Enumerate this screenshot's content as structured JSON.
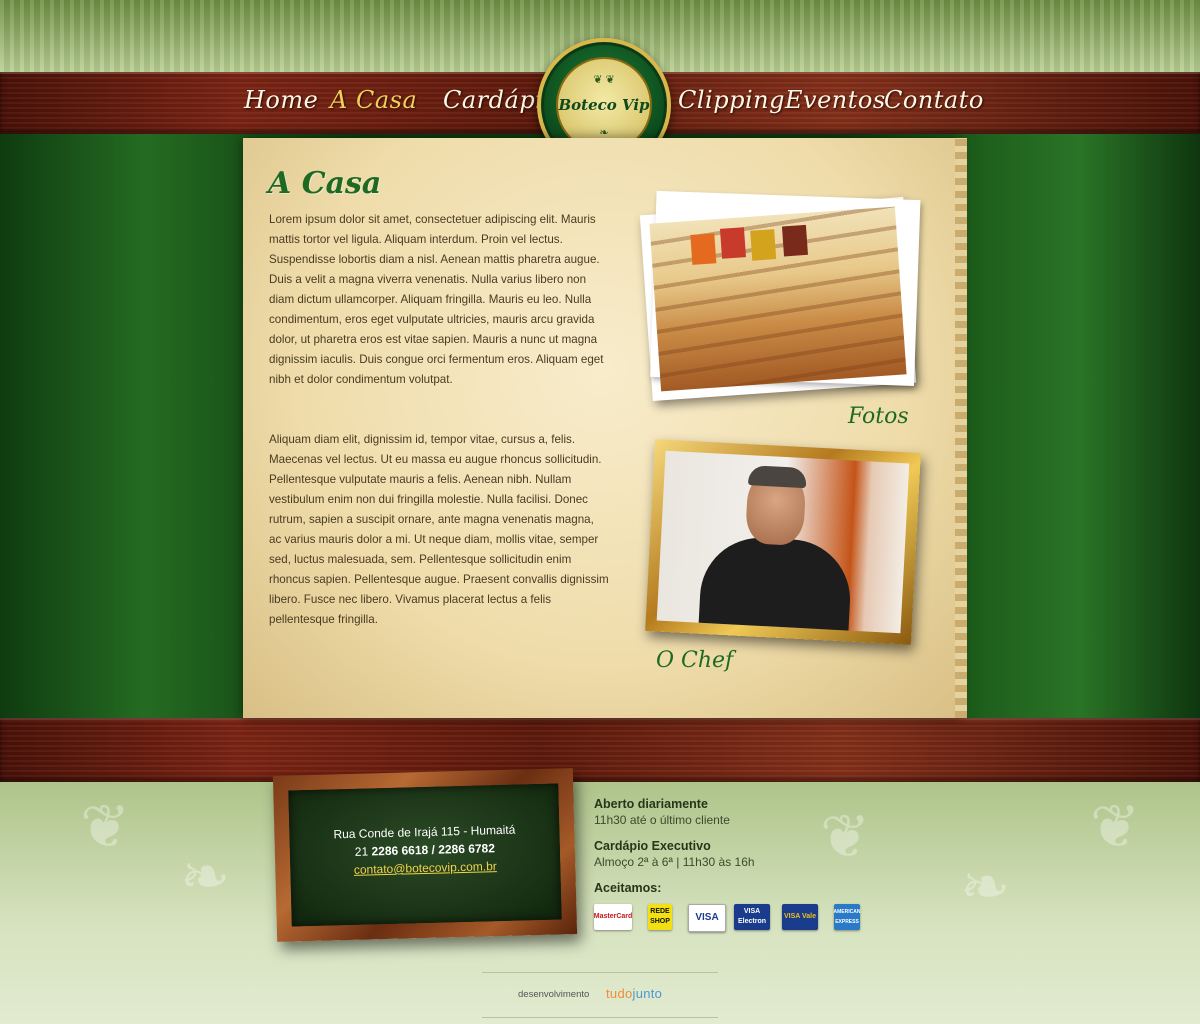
{
  "nav": {
    "items": [
      "Home",
      "A Casa",
      "Cardápio",
      "Clipping",
      "Eventos",
      "Contato"
    ],
    "active": "A Casa"
  },
  "logo": {
    "text": "Boteco Vip"
  },
  "page": {
    "title": "A Casa",
    "paragraph1": "Lorem ipsum dolor sit amet, consectetuer adipiscing elit. Mauris mattis tortor vel ligula. Aliquam interdum. Proin vel lectus. Suspendisse lobortis diam a nisl. Aenean mattis pharetra augue. Duis a velit a magna viverra venenatis. Nulla varius libero non diam dictum ullamcorper. Aliquam fringilla. Mauris eu leo. Nulla condimentum, eros eget vulputate ultricies, mauris arcu gravida dolor, ut pharetra eros est vitae sapien. Mauris a nunc ut magna dignissim iaculis. Duis congue orci fermentum eros. Aliquam eget nibh et dolor condimentum volutpat.",
    "paragraph2": "Aliquam diam elit, dignissim id, tempor vitae, cursus a, felis. Maecenas vel lectus. Ut eu massa eu augue rhoncus sollicitudin. Pellentesque vulputate mauris a felis. Aenean nibh. Nullam vestibulum enim non dui fringilla molestie. Nulla facilisi. Donec rutrum, sapien a suscipit ornare, ante magna venenatis magna, ac varius mauris dolor a mi. Ut neque diam, mollis vitae, semper sed, luctus malesuada, sem. Pellentesque sollicitudin enim rhoncus sapien. Pellentesque augue. Praesent convallis dignissim libero. Fusce nec libero. Vivamus placerat lectus a felis pellentesque fringilla.",
    "caption_photos": "Fotos",
    "caption_chef": "O Chef"
  },
  "footer": {
    "address": "Rua Conde de Irajá 115 - Humaitá",
    "phone_prefix": "21",
    "phone": "2286 6618 / 2286 6782",
    "email": "contato@botecovip.com.br",
    "hours_heading": "Aberto diariamente",
    "hours_text": "11h30 até o último cliente",
    "menu_heading": "Cardápio Executivo",
    "menu_text": "Almoço 2ª à 6ª | 11h30 às 16h",
    "cards_heading": "Aceitamos:",
    "cards": [
      "MasterCard",
      "REDE SHOP",
      "VISA",
      "VISA Electron",
      "VISA Vale",
      "AMERICAN EXPRESS"
    ],
    "credits_label": "desenvolvimento",
    "credits_brand_a": "tudo",
    "credits_brand_b": "junto"
  },
  "colors": {
    "accent_green": "#1e6a23",
    "active_nav": "#f0cf5a",
    "email_link": "#f2d24a"
  }
}
